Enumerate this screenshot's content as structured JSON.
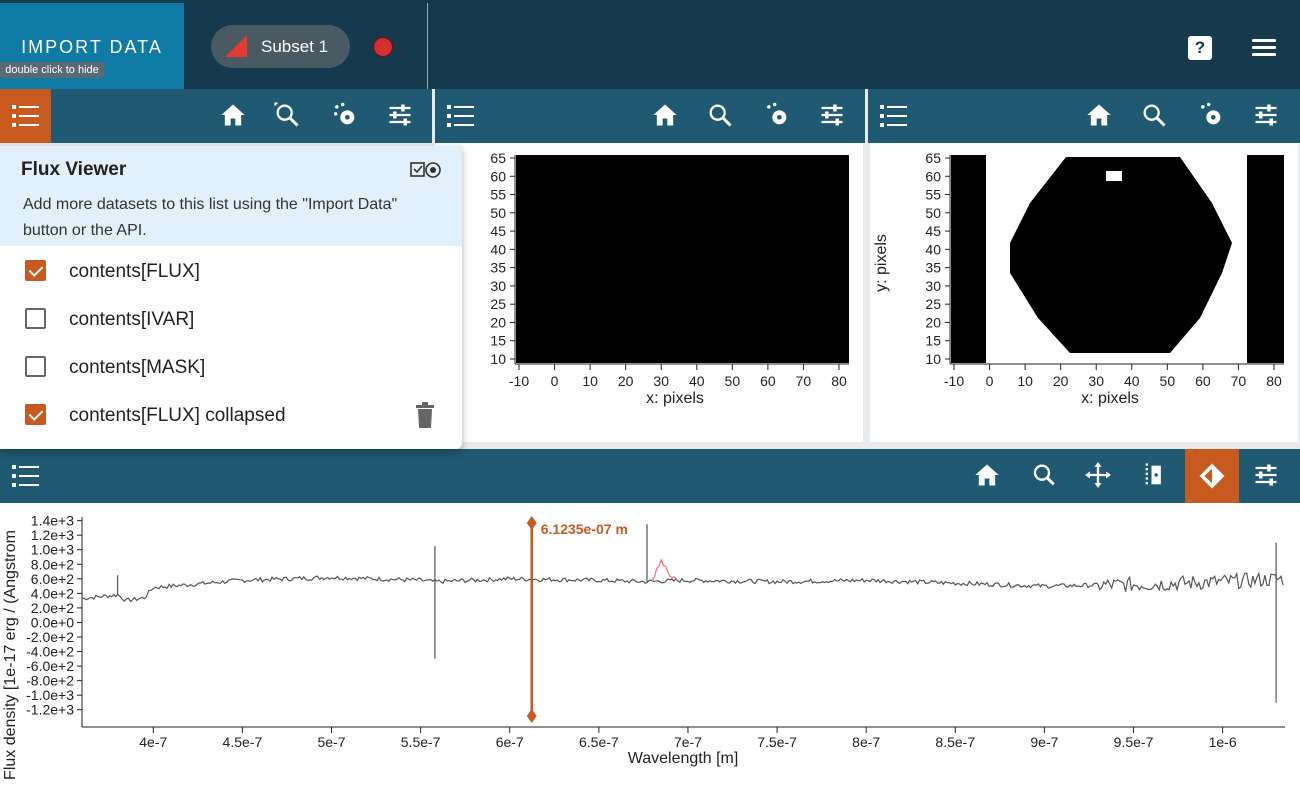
{
  "topbar": {
    "import_label": "IMPORT DATA",
    "tooltip": "double click to hide",
    "subset_label": "Subset 1",
    "help_icon": "?",
    "colors": {
      "bar": "#153a4d",
      "import": "#0f7aa3",
      "subset_swatch": "#e53935"
    }
  },
  "data_menu": {
    "title": "Flux Viewer",
    "hint": "Add more datasets to this list using the \"Import Data\" button or the API.",
    "items": [
      {
        "label": "contents[FLUX]",
        "checked": true
      },
      {
        "label": "contents[IVAR]",
        "checked": false
      },
      {
        "label": "contents[MASK]",
        "checked": false
      },
      {
        "label": "contents[FLUX] collapsed",
        "checked": true
      }
    ]
  },
  "image_viewer_1": {
    "xlabel": "x: pixels",
    "x_ticks": [
      "-10",
      "0",
      "10",
      "20",
      "30",
      "40",
      "50",
      "60",
      "70",
      "80"
    ],
    "y_ticks": [
      "65",
      "60",
      "55",
      "50",
      "45",
      "40",
      "35",
      "30",
      "25",
      "20",
      "15",
      "10"
    ]
  },
  "image_viewer_2": {
    "xlabel": "x: pixels",
    "ylabel": "y: pixels",
    "x_ticks": [
      "-10",
      "0",
      "10",
      "20",
      "30",
      "40",
      "50",
      "60",
      "70",
      "80"
    ],
    "y_ticks": [
      "65",
      "60",
      "55",
      "50",
      "45",
      "40",
      "35",
      "30",
      "25",
      "20",
      "15",
      "10"
    ]
  },
  "chart_data": {
    "type": "line",
    "xlabel": "Wavelength [m]",
    "ylabel": "Flux density [1e-17 erg / (Angstrom",
    "x_ticks": [
      "4e-7",
      "4.5e-7",
      "5e-7",
      "5.5e-7",
      "6e-7",
      "6.5e-7",
      "7e-7",
      "7.5e-7",
      "8e-7",
      "8.5e-7",
      "9e-7",
      "9.5e-7",
      "1e-6"
    ],
    "y_ticks": [
      "1.4e+3",
      "1.2e+3",
      "1.0e+3",
      "8.0e+2",
      "6.0e+2",
      "4.0e+2",
      "2.0e+2",
      "0.0e+0",
      "-2.0e+2",
      "-4.0e+2",
      "-6.0e+2",
      "-8.0e+2",
      "-1.0e+3",
      "-1.2e+3"
    ],
    "xlim": [
      3.6e-07,
      1.035e-06
    ],
    "ylim": [
      -1300.0,
      1450.0
    ],
    "marker": {
      "x": 6.1235e-07,
      "label": "6.1235e-07 m",
      "color": "#c75a1e"
    },
    "series": [
      {
        "color": "#555555",
        "approx_points": [
          [
            3.6e-07,
            330
          ],
          [
            3.8e-07,
            380
          ],
          [
            3.85e-07,
            300
          ],
          [
            3.95e-07,
            340
          ],
          [
            4e-07,
            480
          ],
          [
            4.5e-07,
            580
          ],
          [
            5e-07,
            620
          ],
          [
            5.5e-07,
            580
          ],
          [
            5.58e-07,
            560
          ],
          [
            6e-07,
            600
          ],
          [
            6.5e-07,
            580
          ],
          [
            6.75e-07,
            560
          ],
          [
            7e-07,
            580
          ],
          [
            7.5e-07,
            560
          ],
          [
            8e-07,
            580
          ],
          [
            8.5e-07,
            540
          ],
          [
            9e-07,
            500
          ],
          [
            9.5e-07,
            520
          ],
          [
            1e-06,
            560
          ],
          [
            1.035e-06,
            600
          ]
        ]
      },
      {
        "color": "#ff6b6b",
        "approx_points": [
          [
            6.8e-07,
            580
          ],
          [
            6.85e-07,
            850
          ],
          [
            6.9e-07,
            640
          ],
          [
            6.95e-07,
            560
          ]
        ]
      }
    ]
  }
}
